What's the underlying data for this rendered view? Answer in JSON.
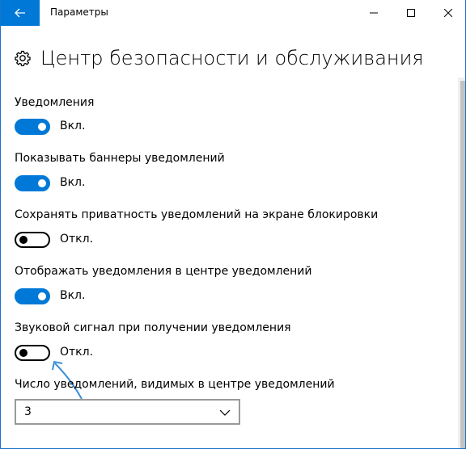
{
  "window": {
    "title": "Параметры",
    "heading": "Центр безопасности и обслуживания",
    "accent_color": "#0078d7"
  },
  "titlebar": {
    "back_icon": "arrow-left-icon",
    "controls": [
      "minimize-icon",
      "maximize-icon",
      "close-icon"
    ]
  },
  "settings": [
    {
      "label": "Уведомления",
      "state": "Вкл.",
      "on": true
    },
    {
      "label": "Показывать баннеры уведомлений",
      "state": "Вкл.",
      "on": true
    },
    {
      "label": "Сохранять приватность уведомлений на экране блокировки",
      "state": "Откл.",
      "on": false
    },
    {
      "label": "Отображать уведомления в центре уведомлений",
      "state": "Вкл.",
      "on": true
    },
    {
      "label": "Звуковой сигнал при получении уведомления",
      "state": "Откл.",
      "on": false
    }
  ],
  "visible_count": {
    "label": "Число уведомлений, видимых в центре уведомлений",
    "selected": "3"
  }
}
